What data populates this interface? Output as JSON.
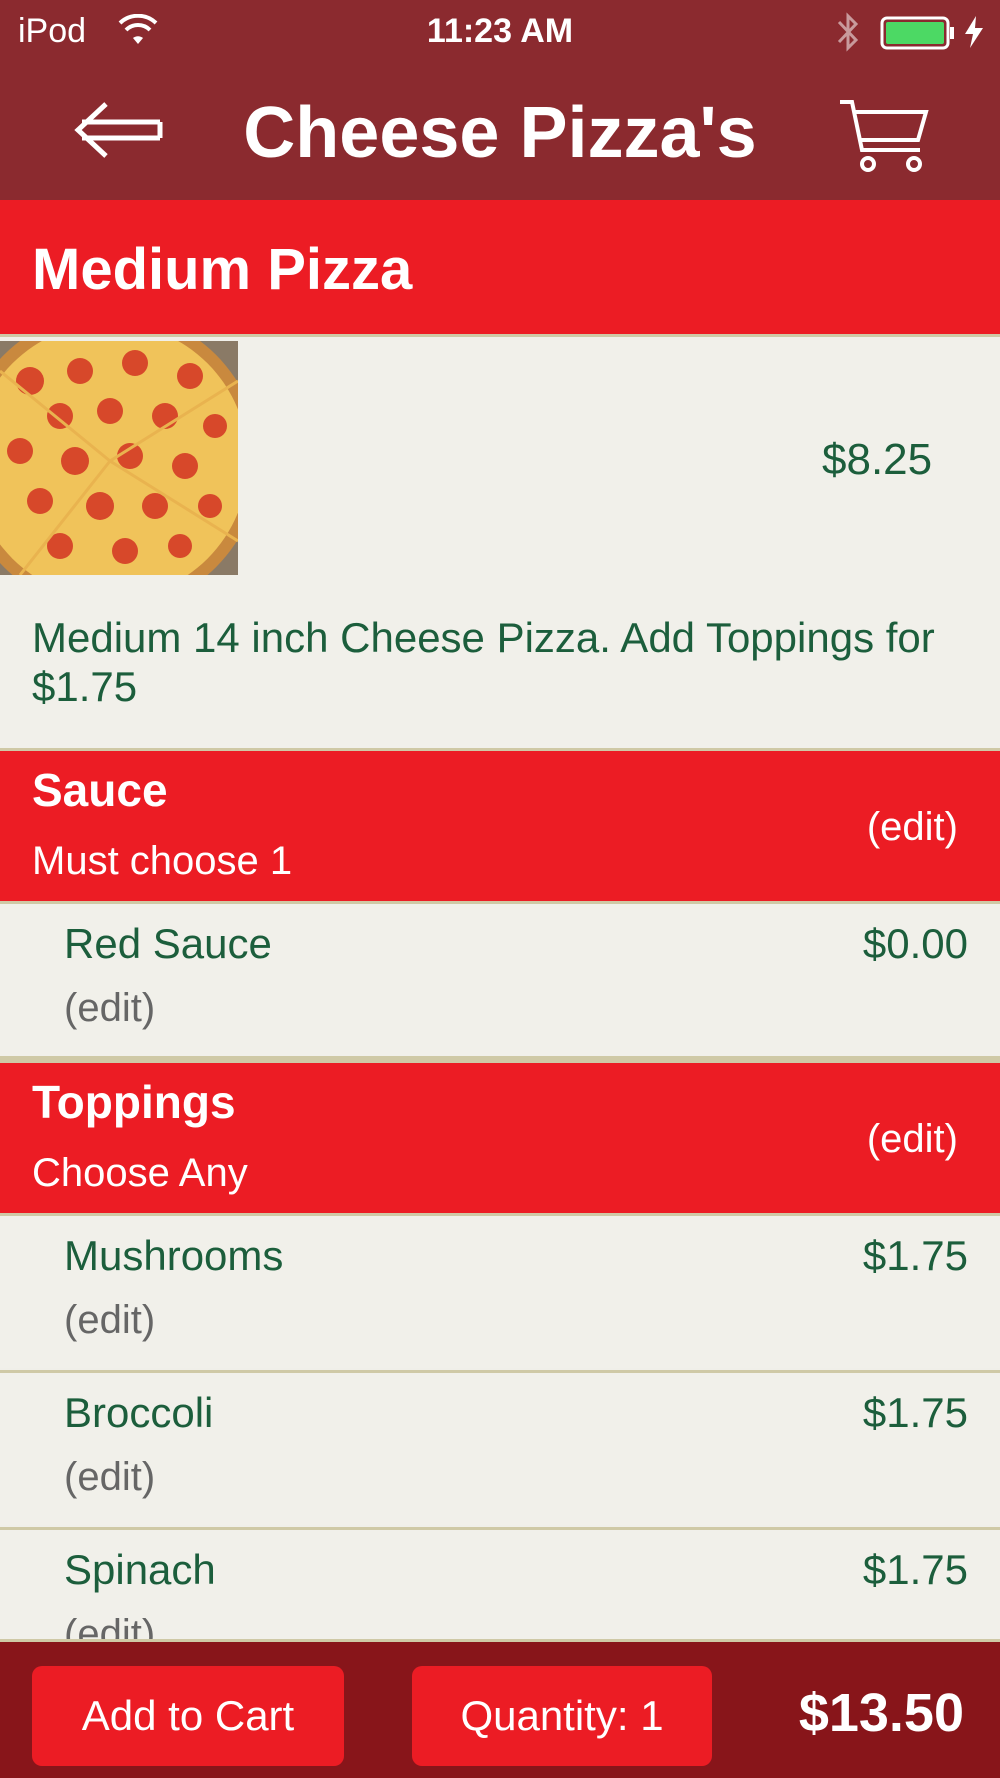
{
  "status_bar": {
    "carrier": "iPod",
    "time": "11:23 AM"
  },
  "nav": {
    "title": "Cheese Pizza's",
    "back_icon": "back-arrow-icon",
    "cart_icon": "cart-icon"
  },
  "item": {
    "name": "Medium  Pizza",
    "price": "$8.25",
    "description": "Medium 14 inch Cheese Pizza. Add Toppings for $1.75"
  },
  "sections": {
    "sauce": {
      "title": "Sauce",
      "subtitle": "Must choose 1",
      "edit_label": "(edit)",
      "options": [
        {
          "label": "Red Sauce",
          "price": "$0.00",
          "edit_label": "(edit)"
        }
      ]
    },
    "toppings": {
      "title": "Toppings",
      "subtitle": "Choose Any",
      "edit_label": "(edit)",
      "options": [
        {
          "label": "Mushrooms",
          "price": "$1.75",
          "edit_label": "(edit)"
        },
        {
          "label": "Broccoli",
          "price": "$1.75",
          "edit_label": "(edit)"
        },
        {
          "label": "Spinach",
          "price": "$1.75",
          "edit_label": "(edit)"
        }
      ]
    }
  },
  "bottom_bar": {
    "add_to_cart": "Add to Cart",
    "quantity": "Quantity: 1",
    "total": "$13.50"
  },
  "colors": {
    "nav_bg": "#8b2a2f",
    "header_red": "#ec1c24",
    "bottom_bg": "#88151a",
    "text_green": "#1c5e3c",
    "row_bg": "#f1f0ea",
    "battery_green": "#4cd964"
  }
}
